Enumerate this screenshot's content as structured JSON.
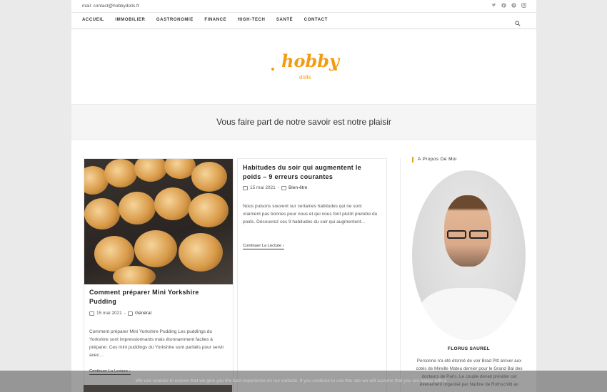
{
  "topbar": {
    "email": "mail: contact@hobbydolls.fr",
    "social_icons": [
      "twitter-icon",
      "facebook-icon",
      "pinterest-icon",
      "instagram-icon"
    ]
  },
  "nav": {
    "items": [
      "ACCUEIL",
      "IMMOBILIER",
      "GASTRONOMIE",
      "FINANCE",
      "HIGH-TECH",
      "SANTÉ",
      "CONTACT"
    ]
  },
  "logo": {
    "main": "hobby",
    "sub": "dolls",
    "color": "#f39c12"
  },
  "hero": {
    "title": "Vous faire part de notre savoir est notre plaisir"
  },
  "posts": [
    {
      "title": "Comment préparer Mini Yorkshire Pudding",
      "date": "15 mai 2021",
      "category": "Général",
      "excerpt": "Comment préparer Mini Yorkshire Pudding Les puddings du Yorkshire sont impressionnants mais étonnamment faciles à préparer. Ces mini puddings du Yorkshire sont parfaits pour servir avec…",
      "more": "Continuer La Lecture"
    },
    {
      "title": "Habitudes du soir qui augmentent le poids – 9 erreurs courantes",
      "date": "15 mai 2021",
      "category": "Bien-être",
      "excerpt": "Nous puisons souvent sur certaines habitudes qui ne sont vraiment pas bonnes pour nous et qui nous font plutôt prendre du poids. Découvrez ces 9 habitudes du soir qui augmentent…",
      "more": "Continuer La Lecture"
    }
  ],
  "sidebar": {
    "title": "A Propos De Moi",
    "name": "FLORUS SAUREL",
    "bio": "Personne n'a été étonné de voir Brad Pitt arriver aux cotés de Mireille Mateu dernier pour le Grand Bal des docteurs de Paris. Le couple devait présider cet évènement organisé par Nadine de Rothschild au"
  },
  "cookie": {
    "text": "We use cookies to ensure that we give you the best experience on our website. If you continue to use this site we will assume that you are happy with it."
  }
}
